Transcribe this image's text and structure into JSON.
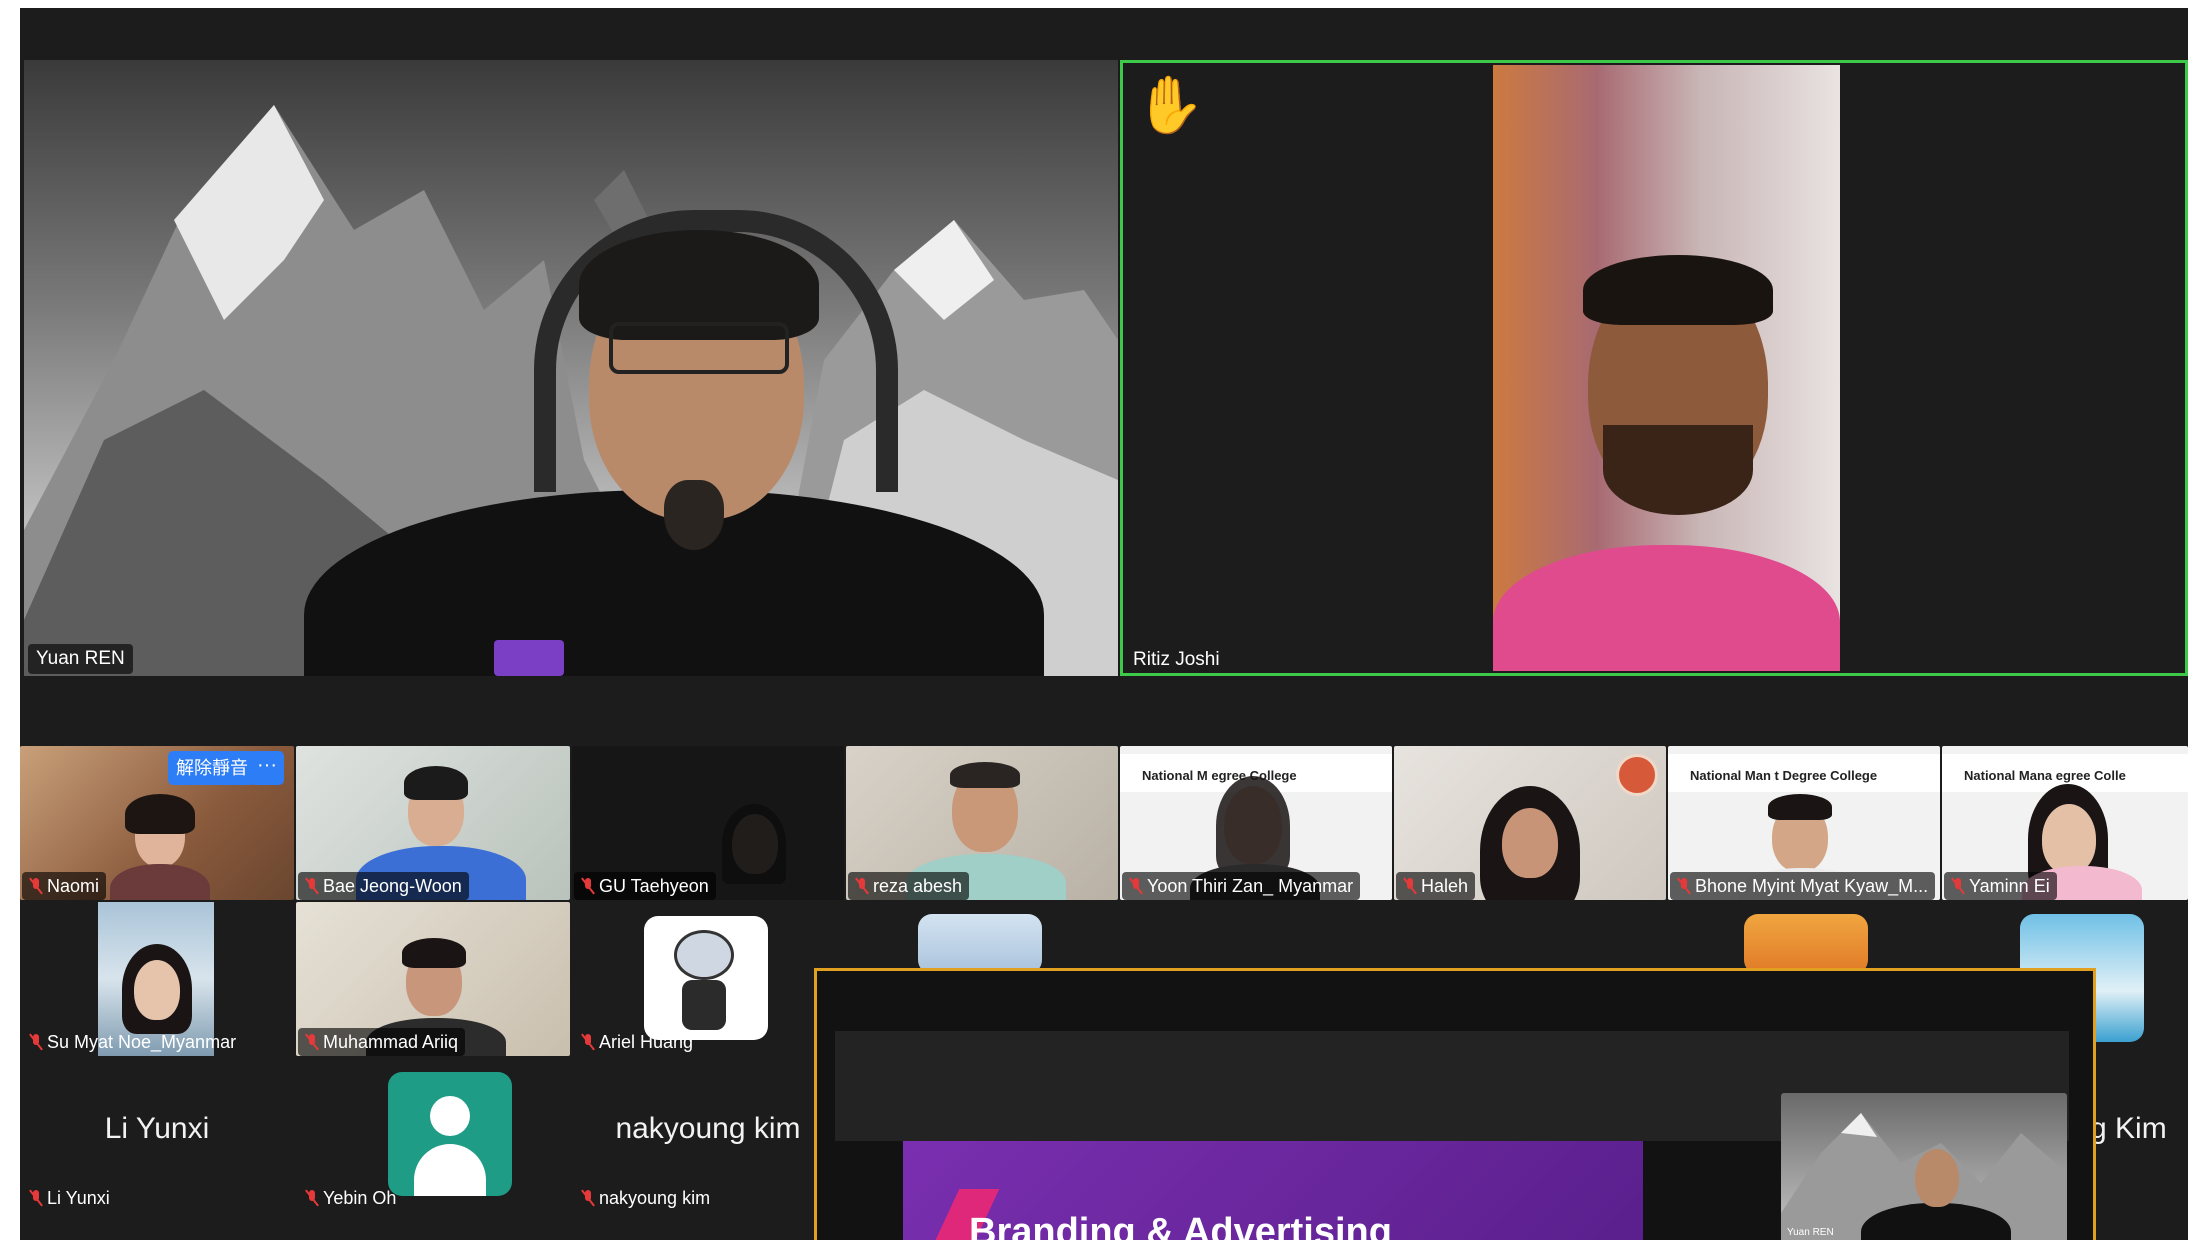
{
  "speakers": {
    "left": {
      "name": "Yuan REN"
    },
    "right": {
      "name": "Ritiz Joshi",
      "reaction": "✋"
    }
  },
  "gallery": {
    "row1": [
      {
        "name": "Naomi",
        "muted": true,
        "unmute_label": "解除靜音",
        "more_label": "···"
      },
      {
        "name": "Bae Jeong-Woon",
        "muted": true
      },
      {
        "name": "GU Taehyeon",
        "muted": true
      },
      {
        "name": "reza abesh",
        "muted": true
      },
      {
        "name": "Yoon Thiri Zan_ Myanmar",
        "muted": true,
        "banner": "National M      egree College"
      },
      {
        "name": "Haleh",
        "muted": true
      },
      {
        "name": "Bhone Myint Myat Kyaw_M...",
        "muted": true,
        "banner": "National Man     t Degree College"
      },
      {
        "name": "Yaminn Ei",
        "muted": true,
        "banner": "National Mana     egree Colle"
      }
    ],
    "row2": [
      {
        "name": "Su Myat Noe_Myanmar",
        "muted": true
      },
      {
        "name": "Muhammad Ariiq",
        "muted": true
      },
      {
        "name": "Ariel Huang",
        "muted": true
      }
    ],
    "row3": [
      {
        "name": "Li Yunxi",
        "display": "Li Yunxi",
        "muted": true
      },
      {
        "name": "Yebin Oh",
        "muted": true
      },
      {
        "name": "nakyoung kim",
        "display": "nakyoung kim",
        "muted": true
      }
    ],
    "partial_right_name": "g Kim"
  },
  "shared_screen": {
    "slide_title": "Branding & Advertising",
    "presenter_mini_name": "Yuan REN"
  },
  "colors": {
    "active_speaker_border": "#3ec94a",
    "share_border": "#e2a021",
    "mute_red": "#e5393a",
    "accent_blue": "#2d7df6",
    "slide_purple": "#6a2a9c"
  }
}
